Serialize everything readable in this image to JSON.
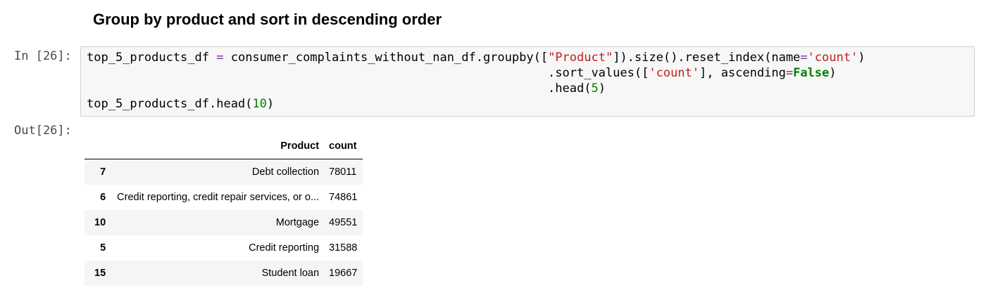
{
  "heading": "Group by product and sort in descending order",
  "input_prompt": "In [26]:",
  "output_prompt": "Out[26]:",
  "code_lines": [
    "top_5_products_df = consumer_complaints_without_nan_df.groupby([\"Product\"]).size().reset_index(name='count')",
    "                                                                .sort_values(['count'], ascending=False)",
    "                                                                .head(5)",
    "top_5_products_df.head(10)"
  ],
  "table": {
    "columns": [
      "",
      "Product",
      "count"
    ],
    "rows": [
      {
        "index": "7",
        "product": "Debt collection",
        "count": "78011"
      },
      {
        "index": "6",
        "product": "Credit reporting, credit repair services, or o...",
        "count": "74861"
      },
      {
        "index": "10",
        "product": "Mortgage",
        "count": "49551"
      },
      {
        "index": "5",
        "product": "Credit reporting",
        "count": "31588"
      },
      {
        "index": "15",
        "product": "Student loan",
        "count": "19667"
      }
    ]
  }
}
